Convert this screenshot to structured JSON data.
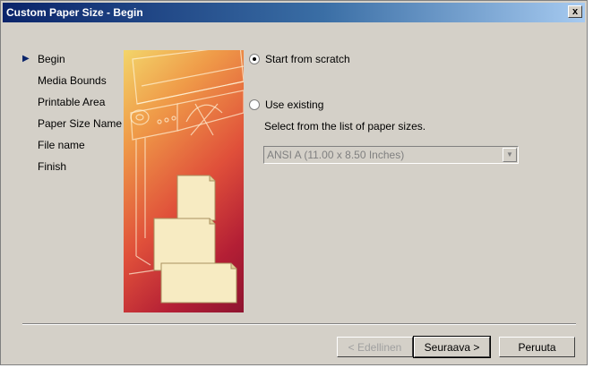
{
  "window": {
    "title": "Custom Paper Size - Begin",
    "close_label": "x"
  },
  "steps": [
    {
      "label": "Begin",
      "active": true
    },
    {
      "label": "Media Bounds"
    },
    {
      "label": "Printable Area"
    },
    {
      "label": "Paper Size Name"
    },
    {
      "label": "File name"
    },
    {
      "label": "Finish"
    }
  ],
  "options": {
    "scratch_label": "Start from scratch",
    "existing_label": "Use existing",
    "selected": "scratch",
    "select_label": "Select from the list of paper sizes.",
    "paper_size_value": "ANSI A (11.00 x 8.50 Inches)",
    "paper_size_enabled": false
  },
  "buttons": {
    "back": "< Edellinen",
    "next": "Seuraava >",
    "cancel": "Peruuta"
  },
  "icons": {
    "step_marker": "arrow-right-icon",
    "dropdown": "chevron-down-icon",
    "close": "close-icon"
  },
  "colors": {
    "titlebar_start": "#0a246a",
    "titlebar_end": "#a6caf0",
    "dialog_bg": "#d4d0c8",
    "step_marker": "#0a246a"
  }
}
